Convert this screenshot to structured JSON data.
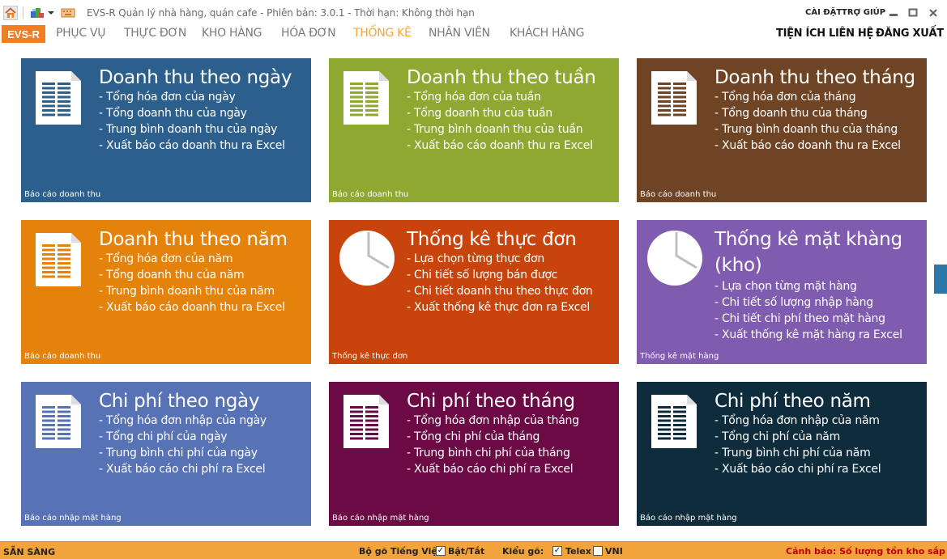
{
  "titlebar": {
    "app_title": "EVS-R Quản lý nhà hàng, quán cafe - Phiên bản: 3.0.1 - Thời hạn: Không thời hạn",
    "settings_label": "CÀI ĐẶT",
    "help_label": "TRỢ GIÚP"
  },
  "ribbon": {
    "app_button": "EVS-R",
    "tabs": [
      {
        "label": "PHỤC VỤ"
      },
      {
        "label": "THỰC ĐƠN"
      },
      {
        "label": "KHO HÀNG"
      },
      {
        "label": "HÓA ĐƠN"
      },
      {
        "label": "THỐNG KÊ"
      },
      {
        "label": "NHÂN VIÊN"
      },
      {
        "label": "KHÁCH HÀNG"
      }
    ],
    "right": [
      {
        "label": "TIỆN ÍCH"
      },
      {
        "label": "LIÊN HỆ"
      },
      {
        "label": "ĐĂNG XUẤT"
      }
    ]
  },
  "tiles": [
    {
      "title": "Doanh thu theo ngày",
      "color": "#2d5f8c",
      "icon": "document-icon",
      "items": [
        "- Tổng hóa đơn của ngày",
        "- Tổng doanh thu của ngày",
        "- Trung bình doanh thu của ngày",
        "- Xuất báo cáo doanh thu ra Excel"
      ],
      "footer": "Báo cáo doanh thu"
    },
    {
      "title": "Doanh thu theo tuần",
      "color": "#8fa831",
      "icon": "document-icon",
      "items": [
        "- Tổng hóa đơn của tuần",
        "- Tổng doanh thu của tuần",
        "- Trung bình doanh thu của tuần",
        "- Xuất báo cáo doanh thu ra Excel"
      ],
      "footer": "Báo cáo doanh thu"
    },
    {
      "title": "Doanh thu theo tháng",
      "color": "#6e4424",
      "icon": "document-icon",
      "items": [
        "- Tổng hóa đơn của tháng",
        "- Tổng doanh thu của tháng",
        "- Trung bình doanh thu của tháng",
        "- Xuất báo cáo doanh thu ra Excel"
      ],
      "footer": "Báo cáo doanh thu"
    },
    {
      "title": "Doanh thu theo năm",
      "color": "#e5820c",
      "icon": "document-icon",
      "items": [
        "- Tổng hóa đơn của năm",
        "- Tổng doanh thu của năm",
        "- Trung bình doanh thu của năm",
        "- Xuất báo cáo doanh thu ra Excel"
      ],
      "footer": "Báo cáo doanh thu"
    },
    {
      "title": "Thống kê thực đơn",
      "color": "#c9440c",
      "icon": "pie-chart-icon",
      "items": [
        "- Lựa chọn từng thực đơn",
        "- Chi tiết số lượng bán được",
        "- Chi tiết doanh thu theo thực đơn",
        "- Xuất thống kê thực đơn ra Excel"
      ],
      "footer": "Thống kê thực đơn"
    },
    {
      "title": "Thống kê mặt khàng (kho)",
      "color": "#7f5cb0",
      "icon": "pie-chart-icon",
      "items": [
        "- Lựa chọn từng mặt hàng",
        "- Chi tiết số lượng nhập hàng",
        "- Chi tiết chi phí theo mặt hàng",
        "- Xuất thống kê mặt hàng ra Excel"
      ],
      "footer": "Thống kê mặt hàng"
    },
    {
      "title": "Chi phí theo ngày",
      "color": "#5773b6",
      "icon": "document-icon",
      "items": [
        "- Tổng hóa đơn nhập của ngày",
        "- Tổng chi phí của ngày",
        "- Trung bình chi phí của ngày",
        "- Xuất báo cáo chi phí ra Excel"
      ],
      "footer": "Báo cáo nhập mặt hàng"
    },
    {
      "title": "Chi phí theo tháng",
      "color": "#6b0a45",
      "icon": "document-icon",
      "items": [
        "- Tổng hóa đơn nhập của tháng",
        "- Tổng chi phí của tháng",
        "- Trung bình chi phí của tháng",
        "- Xuất báo cáo chi phí ra Excel"
      ],
      "footer": "Báo cáo nhập mặt hàng"
    },
    {
      "title": "Chi phí theo năm",
      "color": "#0e2c3b",
      "icon": "document-icon",
      "items": [
        "- Tổng hóa đơn nhập của năm",
        "- Tổng chi phí của năm",
        "- Trung bình chi phí của năm",
        "- Xuất báo cáo chi phí ra Excel"
      ],
      "footer": "Báo cáo nhập mặt hàng"
    }
  ],
  "statusbar": {
    "ready": "SẴN SÀNG",
    "ime_label": "Bộ gõ Tiếng Việt",
    "toggle_label": "Bật/Tắt",
    "toggle_checked": true,
    "input_method_label": "Kiểu gõ:",
    "telex_label": "Telex",
    "telex_checked": true,
    "vni_label": "VNI",
    "vni_checked": false,
    "warning": "Cảnh báo: Số lượng tồn kho sắp hết"
  }
}
